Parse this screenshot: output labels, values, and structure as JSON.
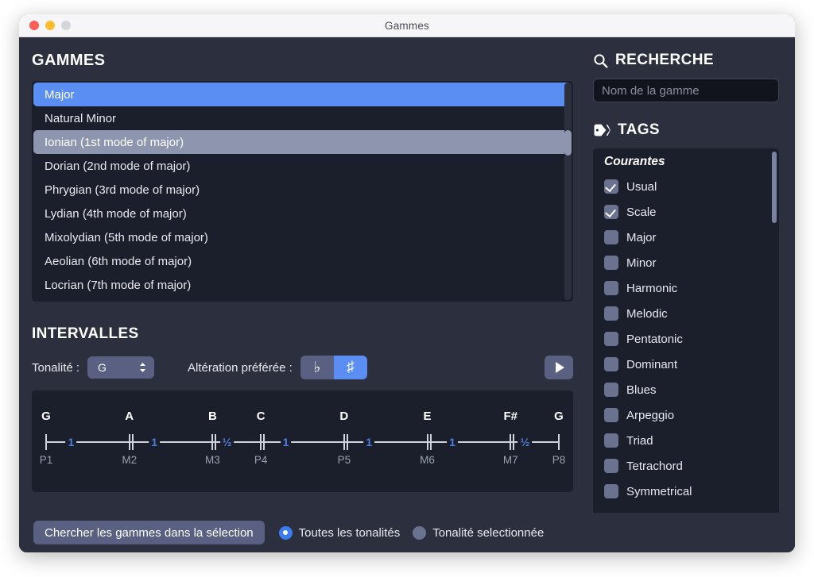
{
  "window": {
    "title": "Gammes",
    "traffic_lights": [
      "close-dot",
      "minimize-dot",
      "maximize-dot"
    ]
  },
  "scales_panel": {
    "header": "GAMMES",
    "header_icon": "",
    "items": [
      {
        "label": "Major",
        "state": "selected"
      },
      {
        "label": "Natural Minor",
        "state": "normal"
      },
      {
        "label": "Ionian (1st mode of major)",
        "state": "hovered"
      },
      {
        "label": "Dorian (2nd mode of major)",
        "state": "normal"
      },
      {
        "label": "Phrygian (3rd mode of major)",
        "state": "normal"
      },
      {
        "label": "Lydian (4th mode of major)",
        "state": "normal"
      },
      {
        "label": "Mixolydian (5th mode of major)",
        "state": "normal"
      },
      {
        "label": "Aeolian (6th mode of major)",
        "state": "normal"
      },
      {
        "label": "Locrian (7th mode of major)",
        "state": "normal"
      }
    ]
  },
  "intervals_panel": {
    "header": "INTERVALLES",
    "key_label": "Tonalité :",
    "key_value": "G",
    "key_stepper_icon": "chevron-up-down-icon",
    "accidental_label": "Altération préférée :",
    "accidental_flat": "♭",
    "accidental_sharp": "♯",
    "accidental_selected": "sharp",
    "play_icon": "play-icon",
    "ruler": {
      "notes": [
        "G",
        "A",
        "B",
        "C",
        "D",
        "E",
        "F#",
        "G"
      ],
      "degrees": [
        "P1",
        "M2",
        "M3",
        "P4",
        "P5",
        "M6",
        "M7",
        "P8"
      ],
      "steps": [
        "1",
        "1",
        "½",
        "1",
        "1",
        "1",
        "½"
      ],
      "tick_kinds": [
        "single",
        "double",
        "double",
        "double",
        "double",
        "double",
        "double",
        "single"
      ]
    }
  },
  "search_panel": {
    "header": "RECHERCHE",
    "header_icon": "search-icon",
    "input_value": "",
    "input_placeholder": "Nom de la gamme"
  },
  "tags_panel": {
    "header": "TAGS",
    "header_icon": "tag-icon",
    "group_label": "Courantes",
    "items": [
      {
        "label": "Usual",
        "checked": true
      },
      {
        "label": "Scale",
        "checked": true
      },
      {
        "label": "Major",
        "checked": false
      },
      {
        "label": "Minor",
        "checked": false
      },
      {
        "label": "Harmonic",
        "checked": false
      },
      {
        "label": "Melodic",
        "checked": false
      },
      {
        "label": "Pentatonic",
        "checked": false
      },
      {
        "label": "Dominant",
        "checked": false
      },
      {
        "label": "Blues",
        "checked": false
      },
      {
        "label": "Arpeggio",
        "checked": false
      },
      {
        "label": "Triad",
        "checked": false
      },
      {
        "label": "Tetrachord",
        "checked": false
      },
      {
        "label": "Symmetrical",
        "checked": false
      }
    ]
  },
  "bottom_bar": {
    "search_selection_label": "Chercher les gammes dans la sélection",
    "radios": [
      {
        "label": "Toutes les tonalités",
        "selected": true
      },
      {
        "label": "Tonalité selectionnée",
        "selected": false
      }
    ]
  },
  "colors": {
    "accent_blue": "#5b8ef2",
    "radio_blue": "#3b7df0",
    "step_blue": "#4d7ee0",
    "panel_bg": "#1b1e2b",
    "window_bg": "#2b2f3e",
    "control_gray": "#596081",
    "hover_gray": "#8e95af"
  }
}
